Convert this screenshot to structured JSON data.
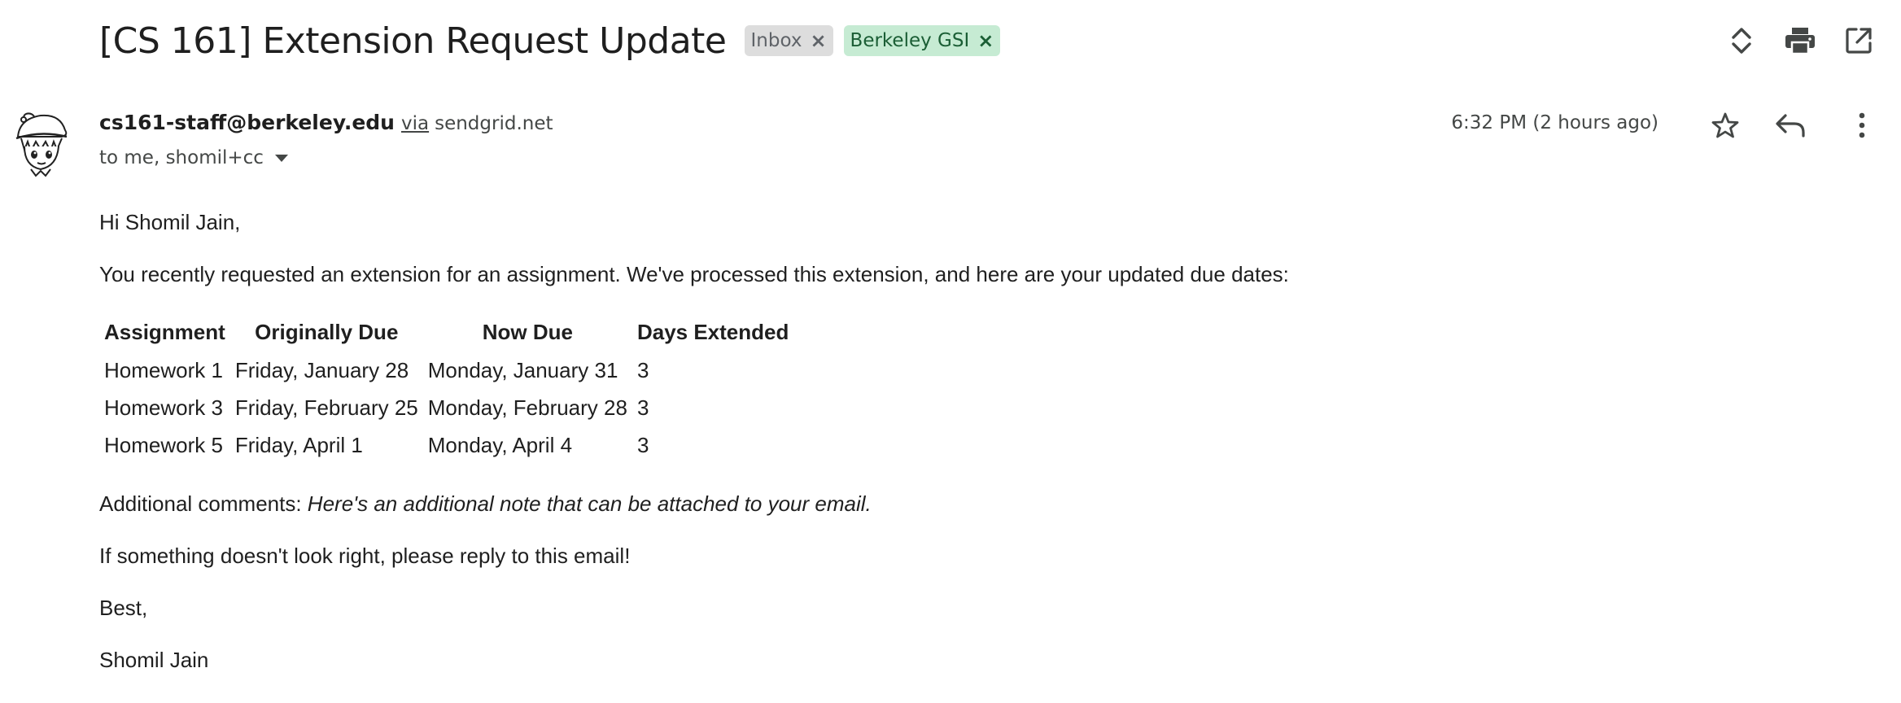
{
  "email": {
    "subject": "[CS 161] Extension Request Update",
    "labels": [
      {
        "name": "Inbox",
        "remove": "×"
      },
      {
        "name": "Berkeley GSI",
        "remove": "×"
      }
    ],
    "sender": {
      "email": "cs161-staff@berkeley.edu",
      "via_label": "via",
      "via_domain": "sendgrid.net",
      "recipients": "to me, shomil+cc"
    },
    "timestamp": "6:32 PM (2 hours ago)",
    "body": {
      "greeting": "Hi Shomil Jain,",
      "intro": "You recently requested an extension for an assignment. We've processed this extension, and here are your updated due dates:",
      "table": {
        "headers": [
          "Assignment",
          "Originally Due",
          "Now Due",
          "Days Extended"
        ],
        "rows": [
          [
            "Homework 1",
            "Friday, January 28",
            "Monday, January 31",
            "3"
          ],
          [
            "Homework 3",
            "Friday, February 25",
            "Monday, February 28",
            "3"
          ],
          [
            "Homework 5",
            "Friday, April 1",
            "Monday, April 4",
            "3"
          ]
        ]
      },
      "comments_label": "Additional comments: ",
      "comments_text": "Here's an additional note that can be attached to your email.",
      "reply_note": "If something doesn't look right, please reply to this email!",
      "signoff": "Best,",
      "signature": "Shomil Jain"
    }
  },
  "icons": {
    "expand": "unfold-icon",
    "print": "print-icon",
    "open_new_window": "open-in-new-window-icon",
    "star": "star-icon",
    "reply": "reply-icon",
    "more": "more-vertical-icon",
    "avatar": "cartoon-avatar"
  },
  "colors": {
    "inbox_chip_bg": "#dddddd",
    "gsi_chip_bg": "#c6ebd3",
    "gsi_chip_text": "#1b5e35",
    "text": "#1f1f1f",
    "secondary_text": "#444746"
  }
}
